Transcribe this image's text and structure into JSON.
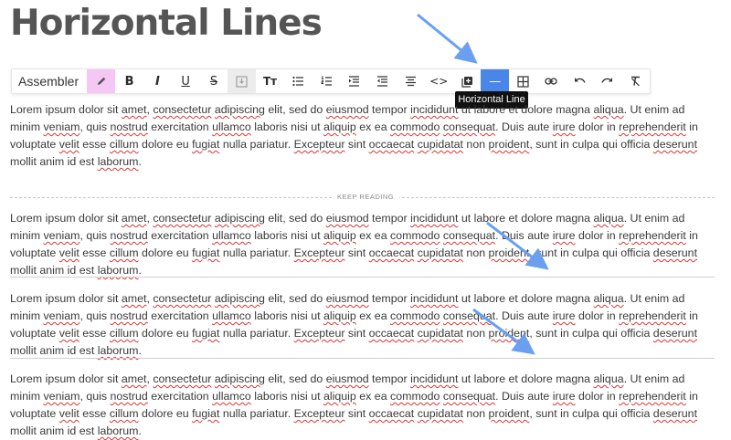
{
  "page": {
    "title": "Horizontal Lines"
  },
  "toolbar": {
    "style_label": "Assembler",
    "buttons": [
      {
        "name": "pencil",
        "glyph": ""
      },
      {
        "name": "bold",
        "glyph": "B"
      },
      {
        "name": "italic",
        "glyph": "I"
      },
      {
        "name": "underline",
        "glyph": "U"
      },
      {
        "name": "strikethrough",
        "glyph": "S"
      },
      {
        "name": "insert-image",
        "glyph": ""
      },
      {
        "name": "font-size",
        "glyph": "Tт"
      },
      {
        "name": "bulleted-list",
        "glyph": ""
      },
      {
        "name": "numbered-list",
        "glyph": ""
      },
      {
        "name": "indent",
        "glyph": ""
      },
      {
        "name": "outdent",
        "glyph": ""
      },
      {
        "name": "align-center",
        "glyph": ""
      },
      {
        "name": "code",
        "glyph": "<>"
      },
      {
        "name": "insert-block",
        "glyph": ""
      },
      {
        "name": "horizontal-line",
        "glyph": "—"
      },
      {
        "name": "table",
        "glyph": ""
      },
      {
        "name": "link",
        "glyph": ""
      },
      {
        "name": "undo",
        "glyph": ""
      },
      {
        "name": "redo",
        "glyph": ""
      },
      {
        "name": "clear-formatting",
        "glyph": ""
      }
    ],
    "tooltip": "Horizontal Line"
  },
  "divider": {
    "keep_reading_label": "KEEP READING"
  },
  "paragraphs": [
    "Lorem ipsum dolor sit amet, consectetur adipiscing elit, sed do eiusmod tempor incididunt ut labore et dolore magna aliqua. Ut enim ad minim veniam, quis nostrud exercitation ullamco laboris nisi ut aliquip ex ea commodo consequat. Duis aute irure dolor in reprehenderit in voluptate velit esse cillum dolore eu fugiat nulla pariatur. Excepteur sint occaecat cupidatat non proident, sunt in culpa qui officia deserunt mollit anim id est laborum.",
    "Lorem ipsum dolor sit amet, consectetur adipiscing elit, sed do eiusmod tempor incididunt ut labore et dolore magna aliqua. Ut enim ad minim veniam, quis nostrud exercitation ullamco laboris nisi ut aliquip ex ea commodo consequat. Duis aute irure dolor in reprehenderit in voluptate velit esse cillum dolore eu fugiat nulla pariatur. Excepteur sint occaecat cupidatat non proident, sunt in culpa qui officia deserunt mollit anim id est laborum.",
    "Lorem ipsum dolor sit amet, consectetur adipiscing elit, sed do eiusmod tempor incididunt ut labore et dolore magna aliqua. Ut enim ad minim veniam, quis nostrud exercitation ullamco laboris nisi ut aliquip ex ea commodo consequat. Duis aute irure dolor in reprehenderit in voluptate velit esse cillum dolore eu fugiat nulla pariatur. Excepteur sint occaecat cupidatat non proident, sunt in culpa qui officia deserunt mollit anim id est laborum.",
    "Lorem ipsum dolor sit amet, consectetur adipiscing elit, sed do eiusmod tempor incididunt ut labore et dolore magna aliqua. Ut enim ad minim veniam, quis nostrud exercitation ullamco laboris nisi ut aliquip ex ea commodo consequat. Duis aute irure dolor in reprehenderit in voluptate velit esse cillum dolore eu fugiat nulla pariatur. Excepteur sint occaecat cupidatat non proident, sunt in culpa qui officia deserunt mollit anim id est laborum."
  ],
  "annotation_color": "#6aa0ef"
}
